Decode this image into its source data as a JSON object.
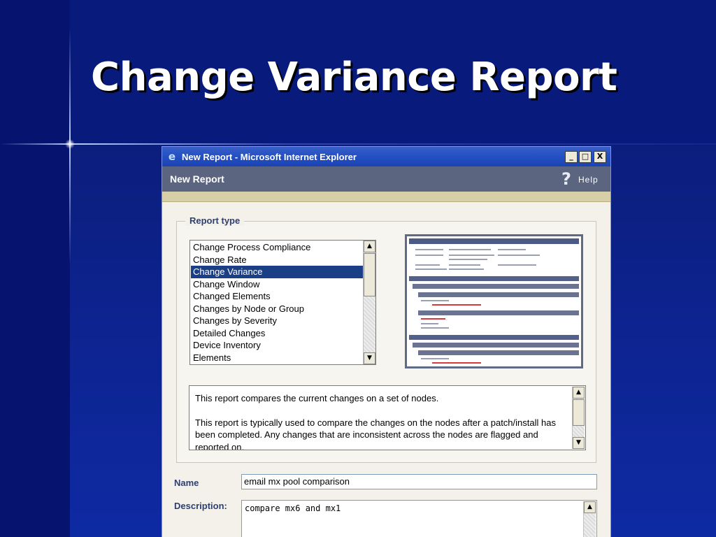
{
  "slide": {
    "title": "Change Variance Report"
  },
  "window": {
    "title": "New Report - Microsoft Internet Explorer",
    "minimize_label": "_",
    "maximize_label": "□",
    "close_label": "X"
  },
  "header": {
    "title": "New Report",
    "help_label": "Help"
  },
  "report_type": {
    "legend": "Report type",
    "items": [
      "Change Process Compliance",
      "Change Rate",
      "Change Variance",
      "Change Window",
      "Changed Elements",
      "Changes by Node or Group",
      "Changes by Severity",
      "Detailed Changes",
      "Device Inventory",
      "Elements"
    ],
    "selected_index": 2,
    "selected_item": "Change Variance"
  },
  "description_box": {
    "paragraph_1": "This report compares the current changes on a set of nodes.",
    "paragraph_2": "This report is typically used to compare the changes on the nodes after a patch/install has been completed. Any changes that are inconsistent across the nodes are flagged and reported on."
  },
  "form": {
    "name_label": "Name",
    "name_value": "email mx pool comparison",
    "description_label": "Description:",
    "description_value": "compare mx6 and mx1"
  },
  "colors": {
    "background": "#0d238f",
    "selection": "#1b3f86",
    "header_bar": "#5b6580",
    "label_text": "#2e3f70"
  }
}
